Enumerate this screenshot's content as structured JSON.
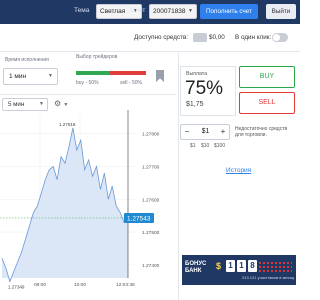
{
  "header": {
    "theme_label": "Тема",
    "theme_value": "Светлая",
    "account_label": "Счет",
    "account_value": "200071838",
    "deposit_button": "Пополнить счет",
    "exit_button": "Выйти"
  },
  "funds": {
    "available_label": "Доступно средств:",
    "badge": "",
    "amount": "$0,00",
    "one_click_label": "В один клик:"
  },
  "settings": {
    "expiry_label": "Время исполнения",
    "expiry_value": "1 мин",
    "traders_label": "Выбор трейдеров",
    "buy_pct": "buy - 50%",
    "sell_pct": "sell - 50%"
  },
  "chart_controls": {
    "interval": "5 мин"
  },
  "trade": {
    "payout_label": "Выплата",
    "payout_pct": "75%",
    "payout_amount": "$1,75",
    "buy": "BUY",
    "sell": "SELL",
    "amount": "$1",
    "minus": "−",
    "plus": "+",
    "quick": [
      "$1",
      "$10",
      "$100"
    ],
    "warning": "Недостаточно средств для торговли.",
    "history": "История"
  },
  "banner": {
    "title_line1": "БОНУС",
    "title_line2": "БАНК",
    "digits": [
      "1",
      "1",
      "8"
    ],
    "caption": "213 121 участников в месяц"
  },
  "chart_data": {
    "type": "area",
    "title": "",
    "xlabel": "",
    "ylabel": "",
    "x_ticks": [
      "08:00",
      "10:00",
      "12:03:38"
    ],
    "y_ticks": [
      "1.27800",
      "1.27700",
      "1.27600",
      "1.27500",
      "1.27400"
    ],
    "ylim": [
      1.2736,
      1.2786
    ],
    "annotations": [
      {
        "label": "1.27818",
        "kind": "high"
      },
      {
        "label": "1.27349",
        "kind": "low"
      }
    ],
    "current_price": "1.27543",
    "series": [
      {
        "values": [
          1.2742,
          1.2739,
          1.27349,
          1.2738,
          1.2741,
          1.2744,
          1.2748,
          1.2752,
          1.2756,
          1.2758,
          1.2762,
          1.2766,
          1.2769,
          1.277,
          1.2766,
          1.2773,
          1.2771,
          1.2776,
          1.27818,
          1.2775,
          1.2778,
          1.2769,
          1.2772,
          1.2767,
          1.277,
          1.2763,
          1.2768,
          1.276,
          1.2764,
          1.2758,
          1.2756,
          1.2753,
          1.27543
        ]
      }
    ]
  }
}
